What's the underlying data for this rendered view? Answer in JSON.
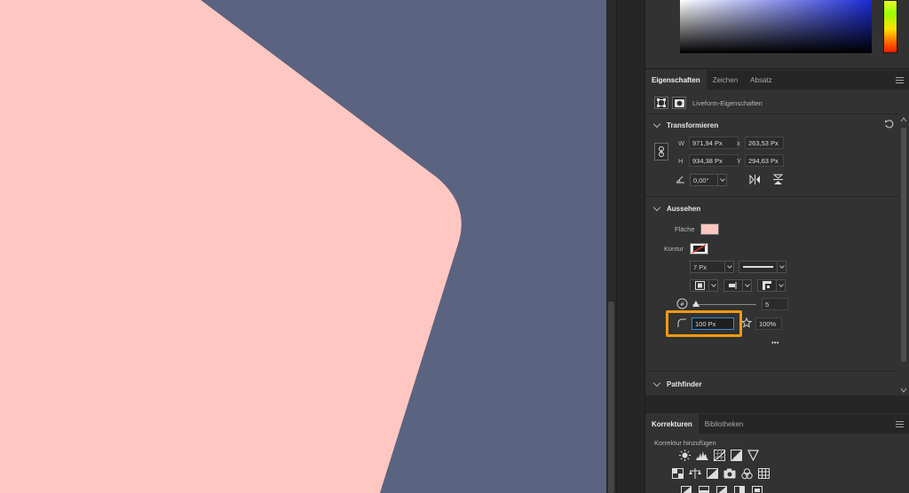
{
  "colors": {
    "canvas_bg": "#5a6380",
    "shape_fill": "#ffc7c1",
    "panel_bg": "#323232",
    "highlight": "#f39b10",
    "contour_stroke": "#e0342a"
  },
  "tabs_top": [
    {
      "label": "Eigenschaften",
      "active": true
    },
    {
      "label": "Zeichen",
      "active": false
    },
    {
      "label": "Absatz",
      "active": false
    }
  ],
  "liveform": {
    "label": "Liveform-Eigenschaften"
  },
  "transform": {
    "title": "Transformieren",
    "w_label": "W",
    "w_value": "971,94 Px",
    "x_label": "x",
    "x_value": "263,53 Px",
    "h_label": "H",
    "h_value": "934,38 Px",
    "y_label": "Y",
    "y_value": "294,63 Px",
    "angle_value": "0,00°"
  },
  "appearance": {
    "title": "Aussehen",
    "fill_label": "Fläche",
    "stroke_label": "Kontur",
    "stroke_width": "7 Px",
    "corners_value": "5",
    "radius_value": "100 Px",
    "percent_value": "100%",
    "more": "•••"
  },
  "pathfinder": {
    "title": "Pathfinder"
  },
  "tabs_bottom": [
    {
      "label": "Korrekturen",
      "active": true
    },
    {
      "label": "Bibliotheken",
      "active": false
    }
  ],
  "adjustments": {
    "title": "Korrektur hinzufügen"
  },
  "icons": {
    "menu": "hamburger-menu-icon",
    "chain": "chain-link-icon",
    "reset": "reset-icon"
  }
}
